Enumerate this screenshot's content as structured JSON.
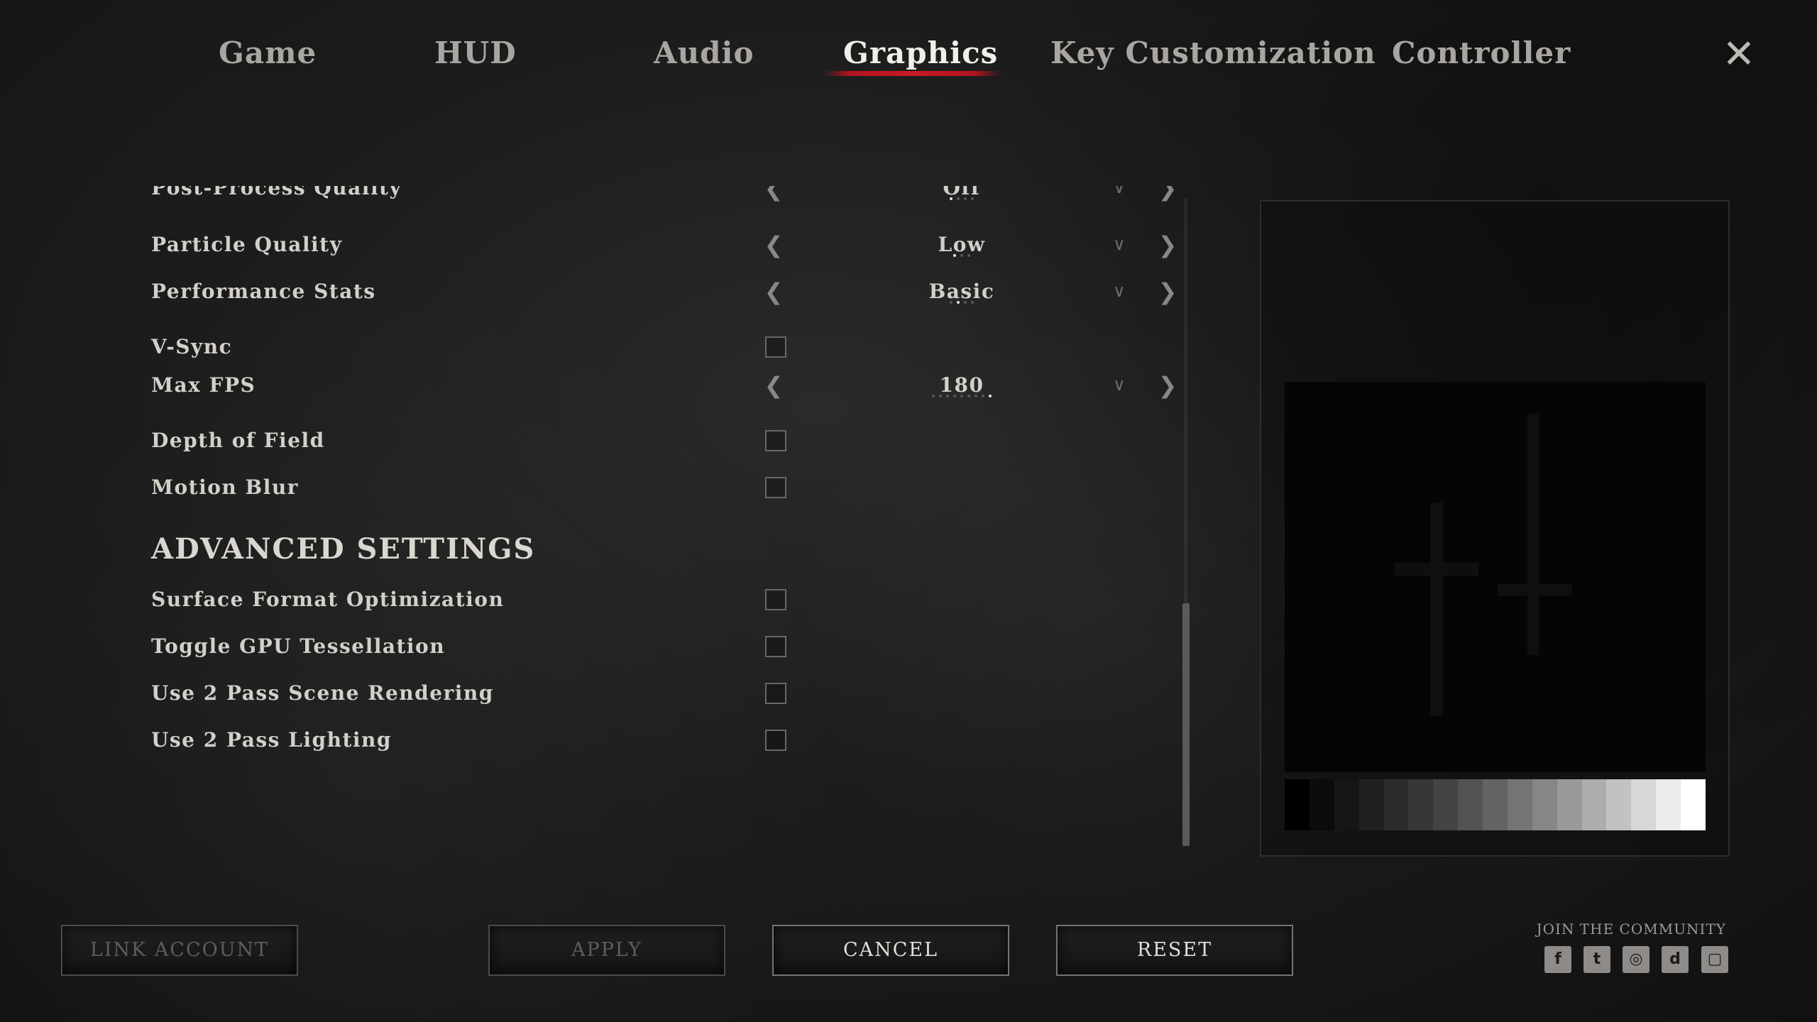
{
  "tabs": [
    {
      "label": "Game"
    },
    {
      "label": "HUD"
    },
    {
      "label": "Audio"
    },
    {
      "label": "Graphics"
    },
    {
      "label": "Key Customization"
    },
    {
      "label": "Controller"
    }
  ],
  "active_tab": "Graphics",
  "close_icon": "close-icon",
  "settings": {
    "post_process": {
      "label": "Post-Process Quality",
      "value": "Off"
    },
    "particle": {
      "label": "Particle Quality",
      "value": "Low"
    },
    "perf_stats": {
      "label": "Performance Stats",
      "value": "Basic"
    },
    "vsync": {
      "label": "V-Sync",
      "checked": false
    },
    "max_fps": {
      "label": "Max FPS",
      "value": "180"
    },
    "dof": {
      "label": "Depth of Field",
      "checked": false
    },
    "motion_blur": {
      "label": "Motion Blur",
      "checked": false
    }
  },
  "advanced": {
    "heading": "ADVANCED SETTINGS",
    "surface_format": {
      "label": "Surface Format Optimization",
      "checked": false
    },
    "gpu_tess": {
      "label": "Toggle GPU Tessellation",
      "checked": false
    },
    "two_pass_scene": {
      "label": "Use 2 Pass Scene Rendering",
      "checked": false
    },
    "two_pass_lighting": {
      "label": "Use 2 Pass Lighting",
      "checked": false
    }
  },
  "buttons": {
    "link_account": "LINK ACCOUNT",
    "apply": "APPLY",
    "cancel": "CANCEL",
    "reset": "RESET"
  },
  "community": {
    "label": "JOIN THE COMMUNITY",
    "icons": [
      "facebook-icon",
      "twitter-icon",
      "instagram-icon",
      "discord-icon",
      "twitch-icon"
    ]
  },
  "colors": {
    "accent": "#c71b24",
    "background": "#1c1c1c"
  }
}
